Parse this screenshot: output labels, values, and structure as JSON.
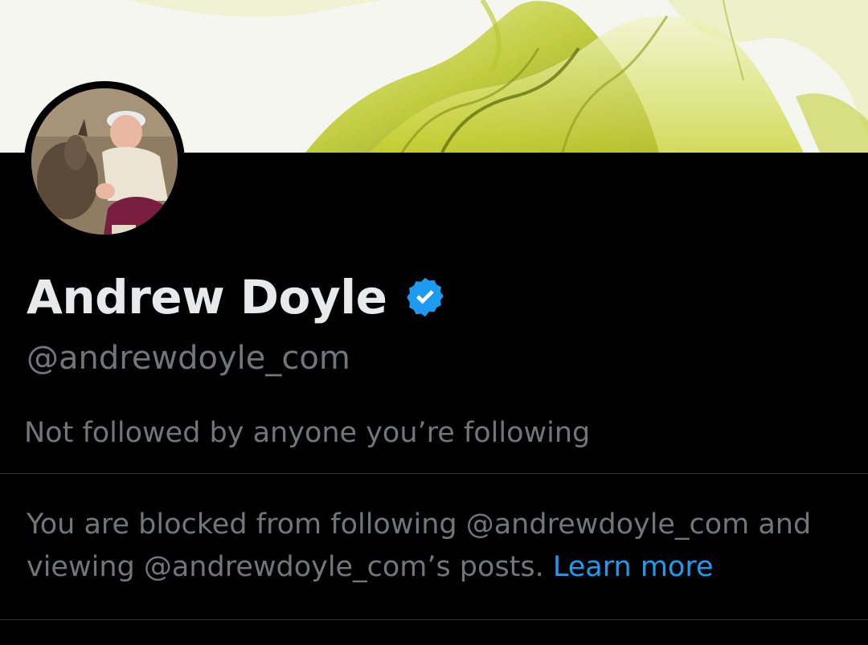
{
  "profile": {
    "display_name": "Andrew Doyle",
    "handle": "@andrewdoyle_com",
    "verified_icon": "verified-badge-icon",
    "followers_note": "Not followed by anyone you’re following"
  },
  "blocked": {
    "text": "You are blocked from following @andrewdoyle_com and viewing @andrewdoyle_com’s posts.",
    "link_label": "Learn more"
  },
  "colors": {
    "background": "#000000",
    "primary_text": "#e7e9ea",
    "secondary_text": "#71767b",
    "accent": "#1d9bf0",
    "divider": "#2f3336"
  }
}
